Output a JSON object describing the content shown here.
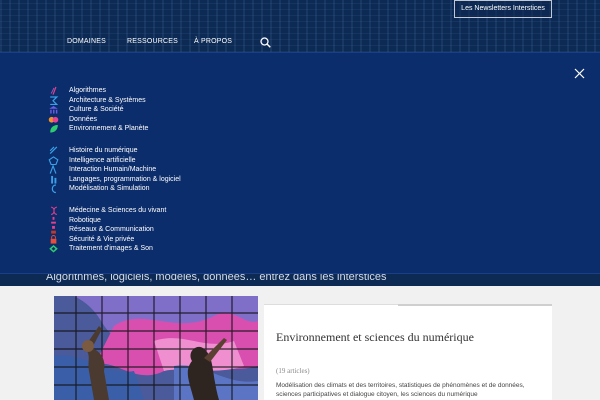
{
  "header": {
    "newsletter_label": "Les Newsletters Interstices",
    "nav": [
      {
        "label": "DOMAINES"
      },
      {
        "label": "RESSOURCES"
      },
      {
        "label": "À PROPOS"
      }
    ],
    "icons": {
      "search": "search-icon",
      "close": "close-icon"
    }
  },
  "menu": {
    "groups": [
      {
        "items": [
          {
            "label": "Algorithmes",
            "icon": "algorithm-icon",
            "color": "#e83e8c"
          },
          {
            "label": "Architecture & Systèmes",
            "icon": "architecture-icon",
            "color": "#3aa0e8"
          },
          {
            "label": "Culture & Société",
            "icon": "culture-icon",
            "color": "#6c5ce7"
          },
          {
            "label": "Données",
            "icon": "data-icon",
            "color": "#f0932b"
          },
          {
            "label": "Environnement & Planète",
            "icon": "leaf-icon",
            "color": "#2ecc71"
          }
        ]
      },
      {
        "items": [
          {
            "label": "Histoire du numérique",
            "icon": "history-icon",
            "color": "#3aa0e8"
          },
          {
            "label": "Intelligence artificielle",
            "icon": "ai-icon",
            "color": "#3aa0e8"
          },
          {
            "label": "Interaction Humain/Machine",
            "icon": "interaction-icon",
            "color": "#3aa0e8"
          },
          {
            "label": "Langages, programmation & logiciel",
            "icon": "code-icon",
            "color": "#3aa0e8"
          },
          {
            "label": "Modélisation & Simulation",
            "icon": "simulation-icon",
            "color": "#3aa0e8"
          }
        ]
      },
      {
        "items": [
          {
            "label": "Médecine & Sciences du vivant",
            "icon": "medicine-icon",
            "color": "#e83e8c"
          },
          {
            "label": "Robotique",
            "icon": "robot-icon",
            "color": "#e83e8c"
          },
          {
            "label": "Réseaux & Communication",
            "icon": "network-icon",
            "color": "#e83e8c"
          },
          {
            "label": "Sécurité & Vie privée",
            "icon": "lock-icon",
            "color": "#e74c3c"
          },
          {
            "label": "Traitement d'images & Son",
            "icon": "image-sound-icon",
            "color": "#2ecc71"
          }
        ]
      }
    ]
  },
  "tagline": "Algorithmes, logiciels, modèles, données… entrez dans les interstices",
  "featured": {
    "title": "Environnement et sciences du numérique",
    "count": "(19 articles)",
    "description": "Modélisation des climats et des territoires, statistiques de phénomènes et de données, sciences participatives et dialogue citoyen, les sciences du numérique"
  }
}
